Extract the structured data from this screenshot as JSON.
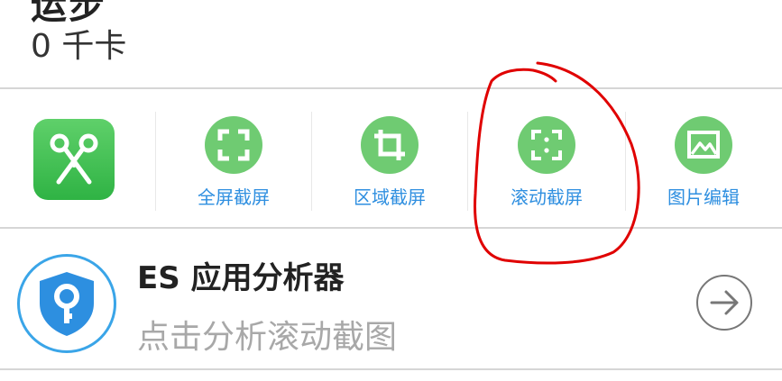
{
  "header": {
    "top_cut_text": "运步",
    "calories": "0 千卡"
  },
  "tools": {
    "app_icon": "scissors-icon",
    "items": [
      {
        "label": "全屏截屏",
        "icon": "fullscreen-capture-icon"
      },
      {
        "label": "区域截屏",
        "icon": "crop-capture-icon"
      },
      {
        "label": "滚动截屏",
        "icon": "scroll-capture-icon"
      },
      {
        "label": "图片编辑",
        "icon": "image-edit-icon"
      }
    ],
    "accent": "#6fcb72",
    "label_color": "#2f8fe0"
  },
  "es_app": {
    "title": "ES 应用分析器",
    "subtitle": "点击分析滚动截图",
    "logo": "shield-key-icon",
    "action_icon": "arrow-right-circle-icon"
  },
  "annotation_color": "#e00000"
}
